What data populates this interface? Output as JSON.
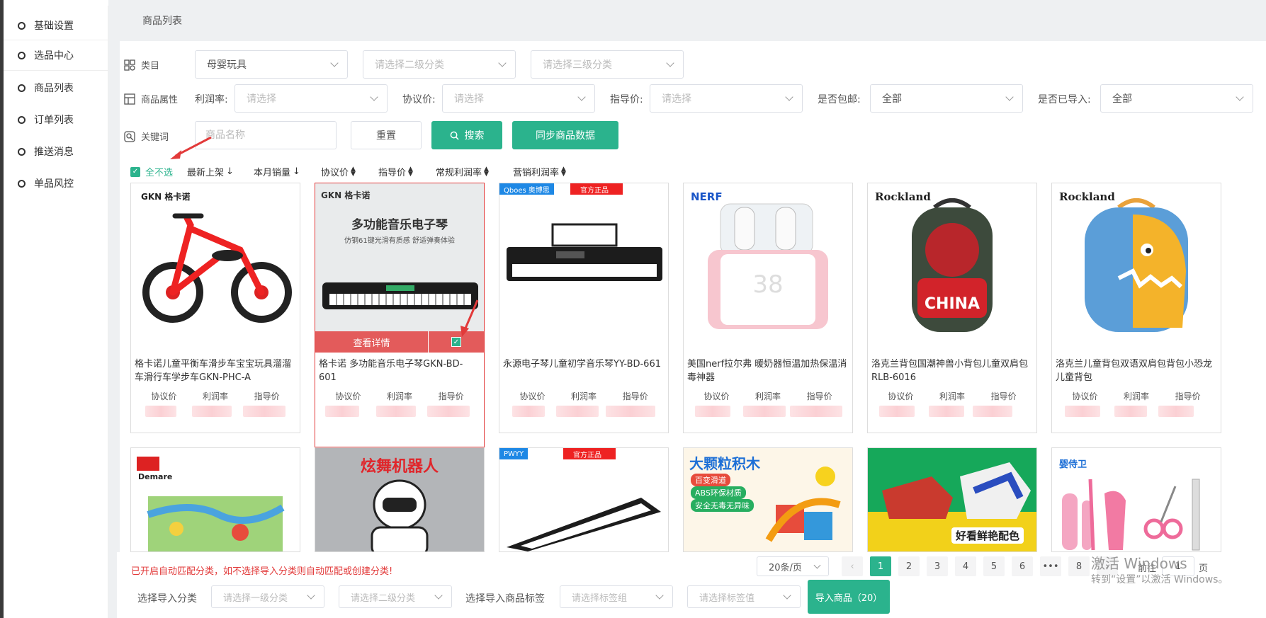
{
  "sidebar": {
    "items": [
      {
        "label": "基础设置"
      },
      {
        "label": "选品中心"
      },
      {
        "label": "商品列表"
      },
      {
        "label": "订单列表"
      },
      {
        "label": "推送消息"
      },
      {
        "label": "单品风控"
      }
    ]
  },
  "breadcrumb": {
    "title": "商品列表"
  },
  "filters": {
    "category_label": "类目",
    "category_value": "母婴玩具",
    "category2_placeholder": "请选择二级分类",
    "category3_placeholder": "请选择三级分类",
    "attr_label": "商品属性",
    "profit_label": "利润率:",
    "profit_placeholder": "请选择",
    "agreed_label": "协议价:",
    "agreed_placeholder": "请选择",
    "guide_label": "指导价:",
    "guide_placeholder": "请选择",
    "freeship_label": "是否包邮:",
    "freeship_value": "全部",
    "imported_label": "是否已导入:",
    "imported_value": "全部",
    "keyword_label": "关键词",
    "keyword_placeholder": "商品名称",
    "reset_label": "重置",
    "search_label": "搜索",
    "sync_label": "同步商品数据"
  },
  "sortbar": {
    "select_all": "全不选",
    "sorts": [
      "最新上架",
      "本月销量",
      "协议价",
      "指导价",
      "常规利润率",
      "营销利润率"
    ]
  },
  "products": [
    {
      "title": "格卡诺儿童平衡车滑步车宝宝玩具溜溜车滑行车学步车GKN-PHC-A",
      "brand": "GKN 格卡诺"
    },
    {
      "title": "格卡诺 多功能音乐电子琴GKN-BD-601",
      "brand": "GKN 格卡诺",
      "banner": "多功能音乐电子琴",
      "banner_sub": "仿钢61键光滑有质感 舒适弹奏体验",
      "detail_label": "查看详情"
    },
    {
      "title": "永源电子琴儿童初学音乐琴YY-BD-661",
      "brand": "Qboes 奥博思",
      "tag": "官方正品"
    },
    {
      "title": "美国nerf拉尔弗 暖奶器恒温加热保温消毒神器",
      "brand": "NERF",
      "display": "38"
    },
    {
      "title": "洛克兰背包国潮神兽小背包儿童双肩包RLB-6016",
      "brand": "Rockland",
      "print": "CHINA"
    },
    {
      "title": "洛克兰儿童背包双语双肩包背包小恐龙儿童背包",
      "brand": "Rockland"
    },
    {
      "title": "",
      "brand": "Demare"
    },
    {
      "title": "",
      "banner": "炫舞机器人"
    },
    {
      "title": "",
      "brand": "PWYY",
      "tag": "官方正品"
    },
    {
      "title": "",
      "banner": "大颗粒积木",
      "lines": [
        "百变滑道",
        "ABS环保材质",
        "安全无毒无异味"
      ]
    },
    {
      "title": "",
      "banner": "好看鲜艳配色"
    },
    {
      "title": "",
      "brand": "婴侍卫"
    }
  ],
  "card_stats": [
    "协议价",
    "利润率",
    "指导价"
  ],
  "bottom": {
    "warning": "已开启自动匹配分类，如不选择导入分类则自动匹配或创建分类!",
    "import_cat_label": "选择导入分类",
    "cat1_placeholder": "请选择一级分类",
    "cat2_placeholder": "请选择二级分类",
    "tag_label": "选择导入商品标签",
    "tag_group_placeholder": "请选择标签组",
    "tag_value_placeholder": "请选择标签值",
    "import_btn": "导入商品（20）"
  },
  "pagination": {
    "page_size": "20条/页",
    "pages": [
      "1",
      "2",
      "3",
      "4",
      "5",
      "6",
      "•••",
      "8"
    ],
    "goto_prefix": "前往",
    "goto_value": "1",
    "goto_suffix": "页"
  },
  "watermark": {
    "line1": "激活 Windows",
    "line2": "转到“设置”以激活 Windows。"
  },
  "colors": {
    "accent": "#2bb38d",
    "danger": "#e23a3a"
  }
}
